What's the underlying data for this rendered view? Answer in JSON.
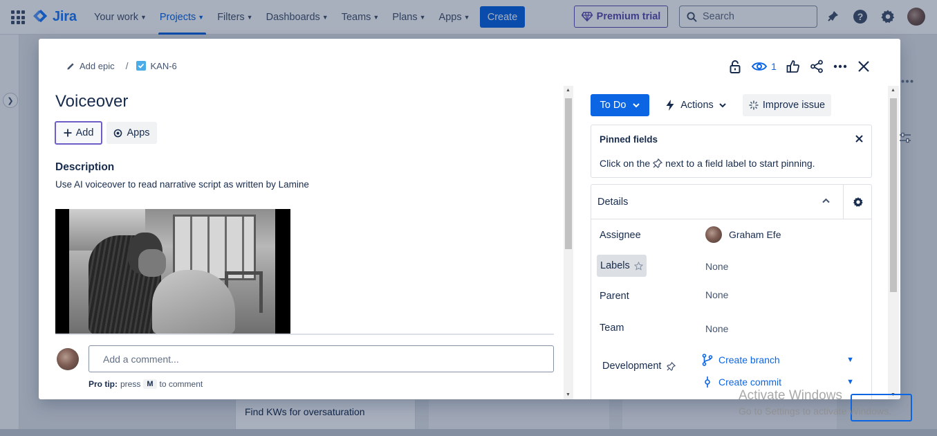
{
  "topnav": {
    "logo_text": "Jira",
    "items": [
      {
        "label": "Your work",
        "active": false
      },
      {
        "label": "Projects",
        "active": true
      },
      {
        "label": "Filters",
        "active": false
      },
      {
        "label": "Dashboards",
        "active": false
      },
      {
        "label": "Teams",
        "active": false
      },
      {
        "label": "Plans",
        "active": false
      },
      {
        "label": "Apps",
        "active": false
      }
    ],
    "create_label": "Create",
    "premium_label": "Premium trial",
    "search_placeholder": "Search",
    "icons": [
      "app-switcher-icon",
      "notifications-icon",
      "help-icon",
      "settings-icon",
      "profile-avatar"
    ]
  },
  "board": {
    "visible_card": "Find KWs for oversaturation"
  },
  "issue": {
    "breadcrumb": {
      "epic_label": "Add epic",
      "separator": "/",
      "key": "KAN-6"
    },
    "watchers_count": "1",
    "title": "Voiceover",
    "add_label": "Add",
    "apps_label": "Apps",
    "description_heading": "Description",
    "description_text": "Use AI voiceover to read narrative script as written by Lamine",
    "comment": {
      "placeholder": "Add a comment...",
      "protip_prefix": "Pro tip:",
      "protip_press": "press",
      "protip_key": "M",
      "protip_suffix": "to comment"
    },
    "status_label": "To Do",
    "actions_label": "Actions",
    "improve_label": "Improve issue",
    "pinned": {
      "title": "Pinned fields",
      "text_before": "Click on the",
      "text_after": "next to a field label to start pinning."
    },
    "details": {
      "title": "Details",
      "fields": {
        "assignee_label": "Assignee",
        "assignee_value": "Graham Efe",
        "labels_label": "Labels",
        "labels_value": "None",
        "parent_label": "Parent",
        "parent_value": "None",
        "team_label": "Team",
        "team_value": "None",
        "development_label": "Development",
        "create_branch": "Create branch",
        "create_commit": "Create commit"
      }
    }
  },
  "watermark": {
    "title": "Activate Windows",
    "subtitle": "Go to Settings to activate Windows."
  },
  "colors": {
    "brand_blue": "#0c66e4",
    "premium_purple": "#5e4db2",
    "text_primary": "#172b4d",
    "text_subtle": "#44546f"
  }
}
